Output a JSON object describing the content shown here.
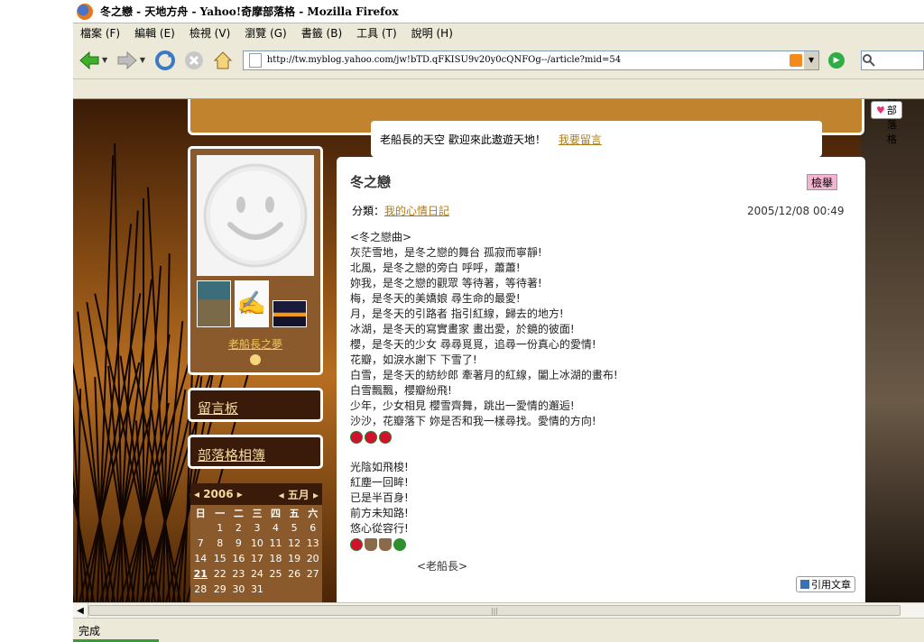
{
  "window": {
    "title": "冬之戀 - 天地方舟 - Yahoo!奇摩部落格 - Mozilla Firefox"
  },
  "menu": [
    "檔案 (F)",
    "編輯 (E)",
    "檢視 (V)",
    "瀏覽 (G)",
    "書籤 (B)",
    "工具 (T)",
    "說明 (H)"
  ],
  "nav": {
    "url": "http://tw.myblog.yahoo.com/jw!bTD.qFKISU9v20y0cQNFOg--/article?mid=54",
    "icons": [
      "back-arrow-icon",
      "forward-arrow-icon",
      "reload-icon",
      "stop-icon",
      "home-icon",
      "rss-icon",
      "go-icon",
      "search-icon"
    ]
  },
  "blog": {
    "subscribe_label": "訂閱部落格",
    "welcome_text": "老船長的天空 歡迎來此遨遊天地！",
    "leave_message_link": "我要留言",
    "owner_name": "老船長之夢",
    "guestbook_label": "留言板",
    "blogroll_label": "部落格相簿"
  },
  "calendar": {
    "year": "2006",
    "month": "五月",
    "weekdays": [
      "日",
      "一",
      "二",
      "三",
      "四",
      "五",
      "六"
    ],
    "weeks": [
      [
        "",
        "1",
        "2",
        "3",
        "4",
        "5",
        "6"
      ],
      [
        "7",
        "8",
        "9",
        "10",
        "11",
        "12",
        "13"
      ],
      [
        "14",
        "15",
        "16",
        "17",
        "18",
        "19",
        "20"
      ],
      [
        "21",
        "22",
        "23",
        "24",
        "25",
        "26",
        "27"
      ],
      [
        "28",
        "29",
        "30",
        "31",
        "",
        "",
        ""
      ]
    ],
    "highlighted_day": "21"
  },
  "article": {
    "title": "冬之戀",
    "report_label": "檢舉",
    "category_label": "分類：",
    "category_link": "我的心情日記",
    "date": "2005/12/08 00:49",
    "body_lines": [
      "<冬之戀曲>",
      "灰茫雪地，是冬之戀的舞台 孤寂而寧靜!",
      "北風，是冬之戀的旁白 呼呼，蕭蕭!",
      "妳我，是冬之戀的觀眾 等待著，等待著!",
      "梅，是冬天的美嬌娘 尋生命的最愛!",
      "月，是冬天的引路者 指引紅線，歸去的地方!",
      "冰湖，是冬天的寫實畫家 畫出愛，於鏡的彼面!",
      "櫻，是冬天的少女 尋尋覓覓，追尋一份真心的愛情!",
      "花瓣，如淚水謝下 下雪了!",
      "白雪，是冬天的紡紗郎 牽著月的紅線，闔上冰湖的畫布!",
      "白雪飄飄，櫻瓣紛飛!",
      "少年，少女相見 櫻雪齊舞，跳出一愛情的邂逅!",
      "沙沙，花瓣落下 妳是否和我一樣尋找。愛情的方向!"
    ],
    "poem2_lines": [
      "光陰如飛梭!",
      "紅塵一回眸!",
      "已是半百身!",
      "前方未知路!",
      "悠心從容行!"
    ],
    "signature": "<老船長>",
    "quote_label": "引用文章"
  },
  "status": {
    "text": "完成"
  }
}
